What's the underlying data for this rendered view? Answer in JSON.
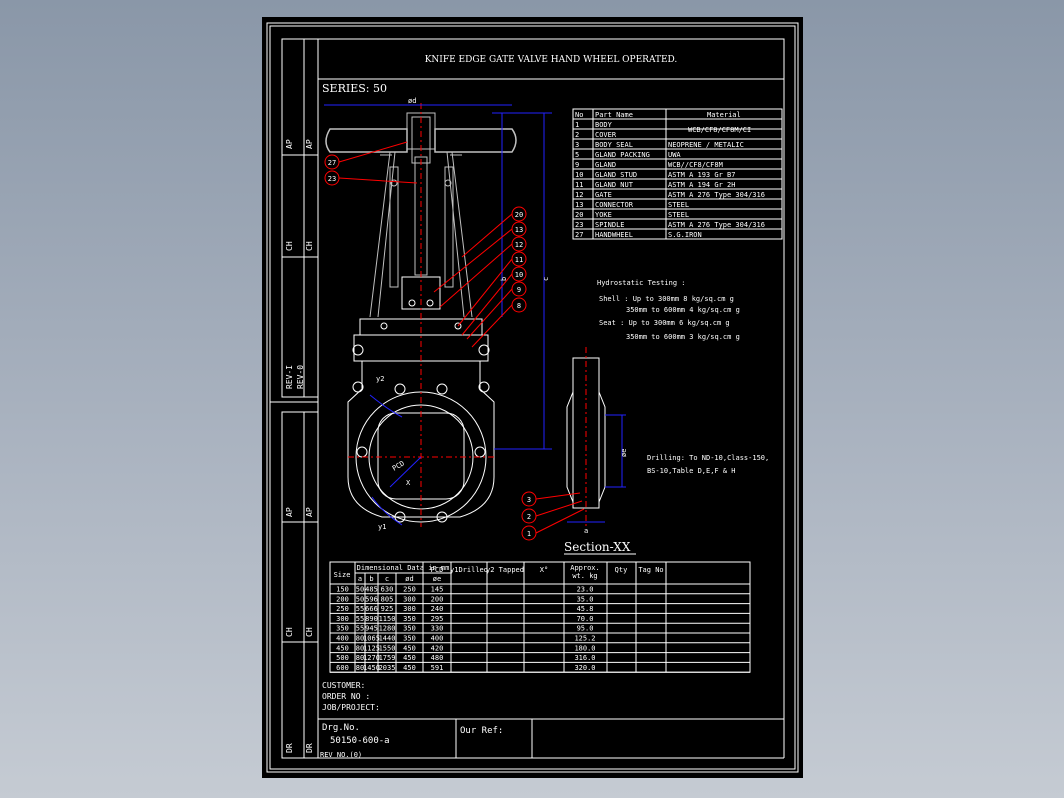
{
  "drawing": {
    "title": "KNIFE EDGE GATE VALVE HAND WHEEL OPERATED.",
    "series": "SERIES: 50",
    "section_label": "Section-XX",
    "rev_left": [
      "AP",
      "CH",
      "DR",
      "AP",
      "CH",
      "DR"
    ],
    "rev_mid": [
      "AP",
      "CH",
      "REV-I",
      "AP",
      "CH",
      "DR"
    ],
    "rev_right": [
      "REV-0"
    ],
    "rev_no": "REV NO.(0)"
  },
  "parts": {
    "headers": [
      "No",
      "Part Name",
      "Material"
    ],
    "rows": [
      [
        "1",
        "BODY",
        "WCB/CF8/CF8M/CI"
      ],
      [
        "2",
        "COVER",
        ""
      ],
      [
        "3",
        "BODY SEAL",
        "NEOPRENE / METALIC"
      ],
      [
        "5",
        "GLAND PACKING",
        "UWA"
      ],
      [
        "9",
        "GLAND",
        "WCB//CF8/CF8M"
      ],
      [
        "10",
        "GLAND STUD",
        "ASTM A 193 Gr B7"
      ],
      [
        "11",
        "GLAND NUT",
        "ASTM A 194 Gr 2H"
      ],
      [
        "12",
        "GATE",
        "ASTM A 276 Type 304/316"
      ],
      [
        "13",
        "CONNECTOR",
        "STEEL"
      ],
      [
        "20",
        "YOKE",
        "STEEL"
      ],
      [
        "23",
        "SPINDLE",
        "ASTM A 276 Type 304/316"
      ],
      [
        "27",
        "HANDWHEEL",
        "S.G.IRON"
      ]
    ]
  },
  "testing": {
    "heading": "Hydrostatic Testing :",
    "lines": [
      "Shell : Up to 300mm  8 kg/sq.cm g",
      "350mm to 600mm 4 kg/sq.cm g",
      "Seat : Up to 300mm  6 kg/sq.cm g",
      "350mm to 600mm 3 kg/sq.cm g"
    ]
  },
  "drilling": [
    "Drilling: To ND-10,Class-150,",
    "BS-10,Table D,E,F & H"
  ],
  "callouts_left": [
    "27",
    "23"
  ],
  "callouts_right": [
    "20",
    "13",
    "12",
    "11",
    "10",
    "9",
    "8"
  ],
  "callouts_section": [
    "3",
    "2",
    "1"
  ],
  "dims": {
    "phi_d": "ød",
    "b": "b",
    "c": "c",
    "y2": "y2",
    "y1": "y1",
    "pcd": "PCD",
    "x": "X",
    "phi_e": "øe",
    "a": "a"
  },
  "dimtable": {
    "size_label": "Size",
    "group_label": "Dimensional Data in mm",
    "sub": [
      "a",
      "b",
      "c",
      "ød",
      "øe"
    ],
    "extra_headers": [
      "PCD",
      "y1Drilled",
      "y2 Tapped",
      "X°",
      "Approx. wt. kg",
      "Qty",
      "Tag No"
    ],
    "rows": [
      [
        "150",
        "50",
        "485",
        "630",
        "250",
        "145",
        "23.0"
      ],
      [
        "200",
        "50",
        "596",
        "805",
        "300",
        "200",
        "35.0"
      ],
      [
        "250",
        "55",
        "666",
        "925",
        "300",
        "240",
        "45.8"
      ],
      [
        "300",
        "55",
        "890",
        "1150",
        "350",
        "295",
        "70.0"
      ],
      [
        "350",
        "55",
        "945",
        "1280",
        "350",
        "330",
        "95.0"
      ],
      [
        "400",
        "80",
        "1065",
        "1440",
        "350",
        "400",
        "125.2"
      ],
      [
        "450",
        "80",
        "1125",
        "1550",
        "450",
        "420",
        "180.0"
      ],
      [
        "500",
        "80",
        "1270",
        "1759",
        "450",
        "480",
        "316.0"
      ],
      [
        "600",
        "80",
        "1450",
        "2035",
        "450",
        "591",
        "320.0"
      ]
    ]
  },
  "footer": {
    "customer": "CUSTOMER:",
    "order": "ORDER NO :",
    "job": "JOB/PROJECT:",
    "drg_label": "Drg.No.",
    "drg_no": "50150-600-a",
    "our_ref": "Our Ref:"
  },
  "colors": {
    "line": "#ffffff",
    "accent": "#ff0000",
    "dim": "#2222ff",
    "yoke": "#c0c0c0"
  }
}
